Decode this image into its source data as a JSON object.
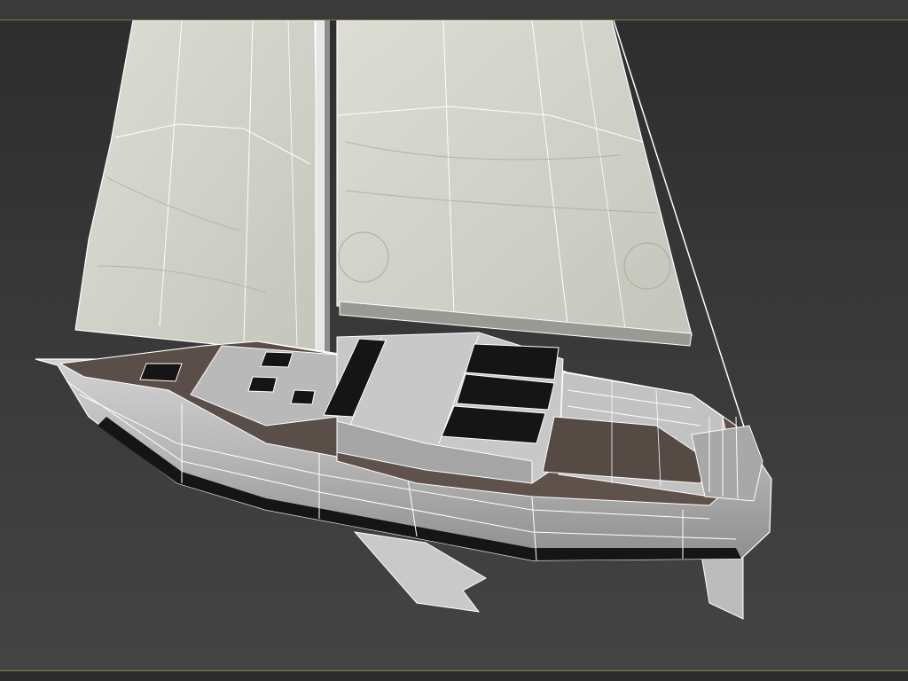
{
  "viewport": {
    "model": "sailboat",
    "shading": "textured-with-wireframe-edges",
    "colors": {
      "frame_border": "#8a7a3a",
      "background_top": "#2e2e2e",
      "background_bottom": "#444444",
      "sail": "#d6d7cf",
      "hull": "#c8c8c8",
      "deck": "#5a4e48",
      "hatch": "#151515",
      "wire": "#ffffff"
    }
  }
}
